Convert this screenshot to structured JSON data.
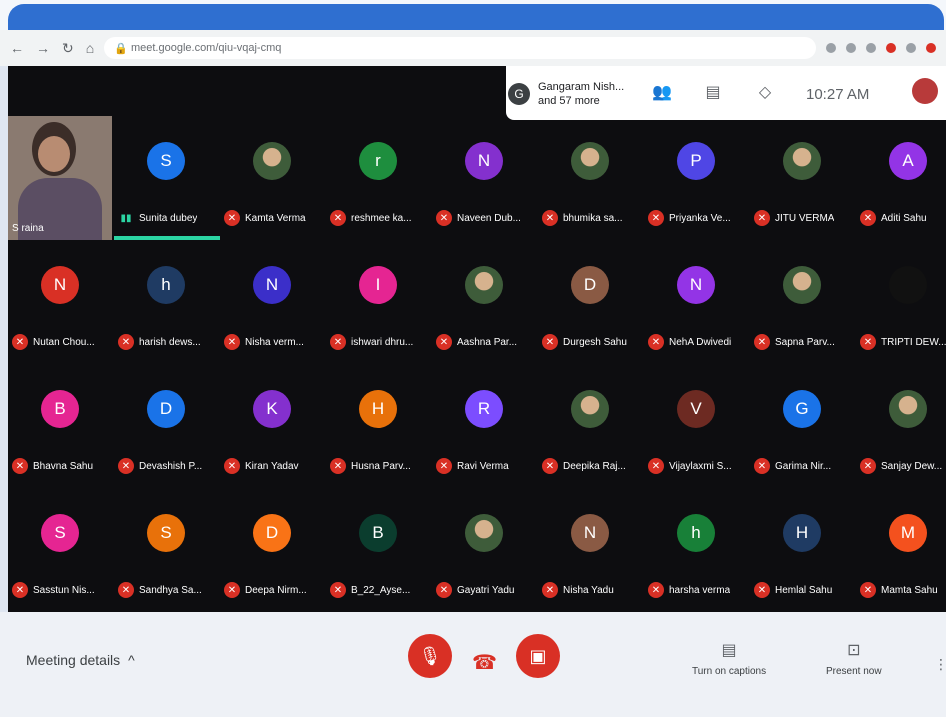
{
  "browser": {
    "url": "meet.google.com/qiu-vqaj-cmq"
  },
  "header": {
    "participants_name": "Gangaram Nish...",
    "participants_more": "and 57 more",
    "clock": "10:27 AM",
    "avatar_letter": "G"
  },
  "self_view": {
    "name": "S raina"
  },
  "participants": [
    {
      "name": "Sunita dubey",
      "letter": "S",
      "color": "#1a73e8",
      "speaking": true
    },
    {
      "name": "Kamta Verma",
      "letter": "",
      "color": "#3e5c3a",
      "photo": true
    },
    {
      "name": "reshmee ka...",
      "letter": "r",
      "color": "#1e8e3e"
    },
    {
      "name": "Naveen Dub...",
      "letter": "N",
      "color": "#8430ce"
    },
    {
      "name": "bhumika sa...",
      "letter": "",
      "color": "#c5221f",
      "photo": true
    },
    {
      "name": "Priyanka Ve...",
      "letter": "P",
      "color": "#4f46e5"
    },
    {
      "name": "JITU VERMA",
      "letter": "",
      "color": "#5f6368",
      "photo": true
    },
    {
      "name": "Aditi Sahu",
      "letter": "A",
      "color": "#9334e6"
    },
    {
      "name": "Nutan Chou...",
      "letter": "N",
      "color": "#d93025"
    },
    {
      "name": "harish dews...",
      "letter": "h",
      "color": "#1f3b63"
    },
    {
      "name": "Nisha verm...",
      "letter": "N",
      "color": "#3b2fc9"
    },
    {
      "name": "ishwari dhru...",
      "letter": "I",
      "color": "#e52592"
    },
    {
      "name": "Aashna Par...",
      "letter": "",
      "color": "#8d8d9a",
      "photo": true
    },
    {
      "name": "Durgesh Sahu",
      "letter": "D",
      "color": "#8a5a44"
    },
    {
      "name": "NehA Dwivedi",
      "letter": "N",
      "color": "#9334e6"
    },
    {
      "name": "Sapna Parv...",
      "letter": "",
      "color": "#d97706",
      "photo": true
    },
    {
      "name": "TRIPTI DEW...",
      "letter": "",
      "color": "#111111"
    },
    {
      "name": "Bhavna Sahu",
      "letter": "B",
      "color": "#e52592"
    },
    {
      "name": "Devashish P...",
      "letter": "D",
      "color": "#1a73e8"
    },
    {
      "name": "Kiran Yadav",
      "letter": "K",
      "color": "#8430ce"
    },
    {
      "name": "Husna Parv...",
      "letter": "H",
      "color": "#e8710a"
    },
    {
      "name": "Ravi Verma",
      "letter": "R",
      "color": "#7c4dff"
    },
    {
      "name": "Deepika Raj...",
      "letter": "",
      "color": "#3e5c3a",
      "photo": true
    },
    {
      "name": "Vijaylaxmi S...",
      "letter": "V",
      "color": "#6d2a22"
    },
    {
      "name": "Garima Nir...",
      "letter": "G",
      "color": "#1a73e8"
    },
    {
      "name": "Sanjay Dew...",
      "letter": "",
      "color": "#4b5563",
      "photo": true
    },
    {
      "name": "Sasstun Nis...",
      "letter": "S",
      "color": "#e52592"
    },
    {
      "name": "Sandhya Sa...",
      "letter": "S",
      "color": "#e8710a"
    },
    {
      "name": "Deepa Nirm...",
      "letter": "D",
      "color": "#f97316"
    },
    {
      "name": "B_22_Ayse...",
      "letter": "B",
      "color": "#0b3d2e"
    },
    {
      "name": "Gayatri Yadu",
      "letter": "",
      "color": "#a16207",
      "photo": true
    },
    {
      "name": "Nisha Yadu",
      "letter": "N",
      "color": "#8a5a44"
    },
    {
      "name": "harsha verma",
      "letter": "h",
      "color": "#188038"
    },
    {
      "name": "Hemlal Sahu",
      "letter": "H",
      "color": "#1f3b63"
    },
    {
      "name": "Mamta Sahu",
      "letter": "M",
      "color": "#f4511e"
    }
  ],
  "footer": {
    "meeting_details": "Meeting details",
    "captions_label": "Turn on captions",
    "present_label": "Present now"
  }
}
